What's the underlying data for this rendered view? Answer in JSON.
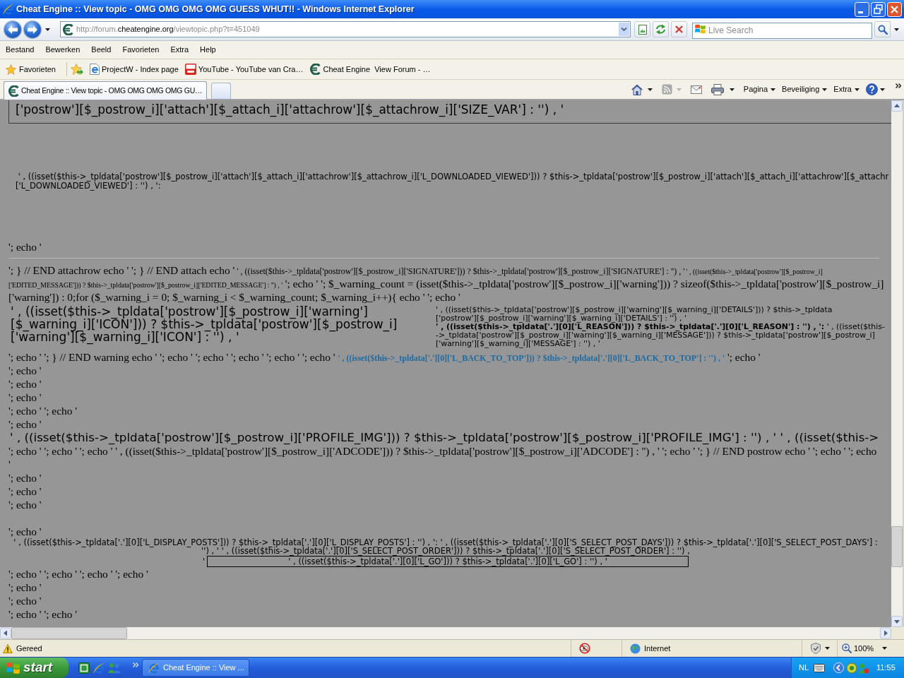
{
  "window": {
    "title": "Cheat Engine :: View topic - OMG OMG OMG OMG GUESS WHUT!! - Windows Internet Explorer"
  },
  "address_bar": {
    "url_parts": [
      {
        "kind": "dim",
        "text": "http://forum."
      },
      {
        "kind": "domain",
        "text": "cheatengine.org"
      },
      {
        "kind": "dim",
        "text": "/viewtopic.php?t=451049"
      }
    ]
  },
  "search": {
    "placeholder": "Live Search"
  },
  "menu_bar": [
    "Bestand",
    "Bewerken",
    "Beeld",
    "Favorieten",
    "Extra",
    "Help"
  ],
  "favorites_bar": {
    "favorites_button": "Favorieten",
    "links": [
      {
        "kind": "page",
        "label": "ProjectW - Index page"
      },
      {
        "kind": "video",
        "label": "YouTube - YouTube van Cra…"
      },
      {
        "kind": "site",
        "label": "Cheat Engine  View Forum - …"
      }
    ]
  },
  "tabs": [
    {
      "label": "Cheat Engine :: View topic - OMG OMG OMG OMG GU…",
      "selected": true
    }
  ],
  "command_bar": {
    "tools": [
      {
        "kind": "home",
        "disabled": false
      },
      {
        "kind": "feeds",
        "disabled": true
      },
      {
        "kind": "mail",
        "disabled": false
      },
      {
        "kind": "print",
        "disabled": false
      }
    ],
    "menus": [
      "Pagina",
      "Beveiliging",
      "Extra"
    ]
  },
  "page": {
    "size_var_box": "['postrow'][$_postrow_i]['attach'][$_attach_i]['attachrow'][$_attachrow_i]['SIZE_VAR'] : '') , '",
    "downloaded_viewed": [
      " ' , ((isset($this->_tpldata['postrow'][$_postrow_i]['attach'][$_attach_i]['attachrow'][$_attachrow_i]['L_DOWNLOADED_VIEWED'])) ? $this->_tpldata['postrow'][$_postrow_i]['attach'][$_attach_i]['attachrow'][$_attachr",
      "['L_DOWNLOADED_VIEWED'] : '') , ':"
    ],
    "echo_before_rule": "'; echo '",
    "after_rule": [
      [
        {
          "kind": "serif",
          "text": "'; } // END attachrow echo ' '; } // END attach echo '"
        },
        {
          "kind": "serif_small",
          "text": " ' , ((isset($this->_tpldata['postrow'][$_postrow_i]['SIGNATURE'])) ? $this->_tpldata['postrow'][$_postrow_i]['SIGNATURE'] : '') , '"
        },
        {
          "kind": "serif_tiny",
          "text": " ' , ((isset($this->_tpldata['postrow'][$_postrow_i]"
        }
      ],
      [
        {
          "kind": "serif_tiny",
          "text": "['EDITED_MESSAGE'])) ? $this->_tpldata['postrow'][$_postrow_i]['EDITED_MESSAGE'] : '') , '"
        },
        {
          "kind": "serif",
          "text": " '; echo ' '; $_warning_count = (isset($this->_tpldata['postrow'][$_postrow_i]['warning'])) ? sizeof($this->_tpldata['postrow'][$_postrow_i]"
        }
      ],
      [
        {
          "kind": "serif",
          "text": "['warning']) : 0;for ($_warning_i = 0; $_warning_i < $_warning_count; $_warning_i++){ echo ' '; echo '"
        }
      ]
    ],
    "warning_icon": [
      "' , ((isset($this->_tpldata['postrow'][$_postrow_i]['warning']",
      "[$_warning_i]['ICON'])) ? $this->_tpldata['postrow'][$_postrow_i]",
      "['warning'][$_warning_i]['ICON'] : '') , '"
    ],
    "warning_details": [
      [
        {
          "kind": "sans",
          "text": "' , ((isset($this->_tpldata['postrow'][$_postrow_i]['warning'][$_warning_i]['DETAILS'])) ? $this->_tpldata"
        }
      ],
      [
        {
          "kind": "sans",
          "text": "['postrow'][$_postrow_i]['warning'][$_warning_i]['DETAILS'] : '') , '"
        }
      ],
      [
        {
          "kind": "sans_bold",
          "text": "' , ((isset($this->_tpldata['.'][0]['L_REASON'])) ? $this->_tpldata['.'][0]['L_REASON'] : '') , ':"
        },
        {
          "kind": "sans",
          "text": " ' , ((isset($this-"
        }
      ],
      [
        {
          "kind": "sans",
          "text": "->_tpldata['postrow'][$_postrow_i]['warning'][$_warning_i]['MESSAGE'])) ? $this->_tpldata['postrow'][$_postrow_i]"
        }
      ],
      [
        {
          "kind": "sans",
          "text": "['warning'][$_warning_i]['MESSAGE'] : '') , '"
        }
      ]
    ],
    "back_to_top": [
      {
        "kind": "serif",
        "text": "'; echo ' '; } // END warning echo ' '; echo ' '; echo ' '; echo ' '; echo ' '; echo ' "
      },
      {
        "kind": "link",
        "text": "' , ((isset($this->_tpldata['.'][0]['L_BACK_TO_TOP'])) ? $this->_tpldata['.'][0]['L_BACK_TO_TOP'] : '') , '"
      },
      {
        "kind": "serif",
        "text": " '; echo '"
      }
    ],
    "echo_lines_1": [
      "'; echo '",
      "'; echo '",
      "'; echo '",
      "'; echo ' '; echo '",
      "'; echo '"
    ],
    "profile_img": "' , ((isset($this->_tpldata['postrow'][$_postrow_i]['PROFILE_IMG'])) ? $this->_tpldata['postrow'][$_postrow_i]['PROFILE_IMG'] : '') , ' ' , ((isset($this->",
    "adcode": [
      "'; echo ' '; echo ' '; echo ' ' , ((isset($this->_tpldata['postrow'][$_postrow_i]['ADCODE'])) ? $this->_tpldata['postrow'][$_postrow_i]['ADCODE'] : '') , ' '; echo ' '; } // END postrow echo ' '; echo ' '; echo",
      "'"
    ],
    "echo_lines_2": [
      "'; echo '",
      "'; echo '",
      "'; echo '"
    ],
    "echo_after_gap": "'; echo '",
    "display_posts": [
      "' , ((isset($this->_tpldata['.'][0]['L_DISPLAY_POSTS'])) ? $this->_tpldata['.'][0]['L_DISPLAY_POSTS'] : '') , ': ' , ((isset($this->_tpldata['.'][0]['S_SELECT_POST_DAYS'])) ? $this->_tpldata['.'][0]['S_SELECT_POST_DAYS'] :",
      "'') , ' ' , ((isset($this->_tpldata['.'][0]['S_SELECT_POST_ORDER'])) ? $this->_tpldata['.'][0]['S_SELECT_POST_ORDER'] : '') ,"
    ],
    "go_row": {
      "quote": "'",
      "button": "' , ((isset($this->_tpldata['.'][0]['L_GO'])) ? $this->_tpldata['.'][0]['L_GO'] : '') , '"
    },
    "echo_lines_3": [
      "'; echo ' '; echo ' '; echo ' '; echo '",
      "'; echo '",
      "'; echo '",
      "'; echo ' '; echo '"
    ]
  },
  "status_bar": {
    "status": "Gereed",
    "zone": "Internet",
    "zoom": "100%"
  },
  "taskbar": {
    "start": "start",
    "tasks": [
      "Cheat Engine :: View ..."
    ],
    "language": "NL",
    "clock": "11:55"
  }
}
